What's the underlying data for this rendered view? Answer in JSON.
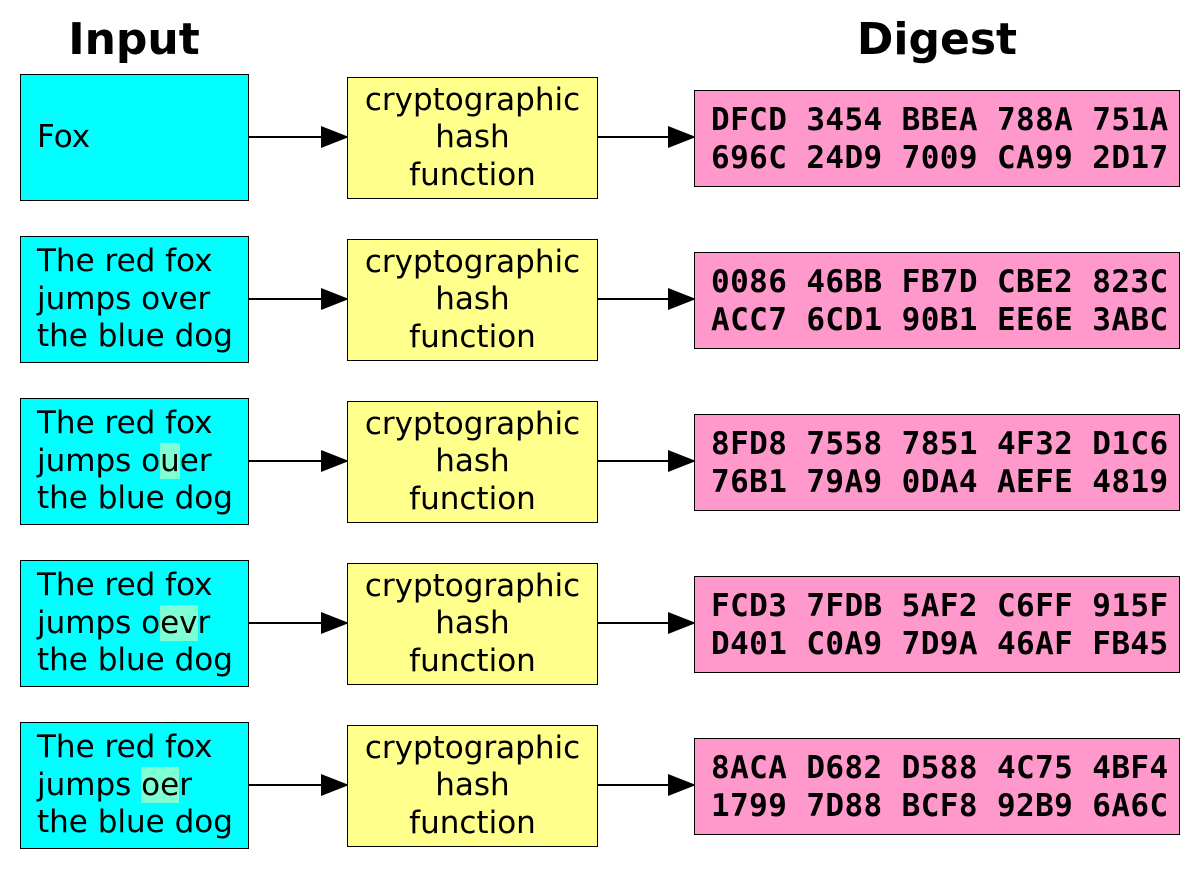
{
  "headers": {
    "input": "Input",
    "digest": "Digest"
  },
  "colors": {
    "input_box": "#00ffff",
    "hash_box": "#ffff8c",
    "digest_box": "#ff99cc",
    "highlight": "#7fffd4"
  },
  "hash_function_label": [
    "cryptographic",
    "hash",
    "function"
  ],
  "rows": [
    {
      "input_lines": [
        [
          {
            "text": "Fox",
            "highlight": false
          }
        ]
      ],
      "digest_lines": [
        "DFCD 3454 BBEA 788A 751A",
        "696C 24D9 7009 CA99 2D17"
      ]
    },
    {
      "input_lines": [
        [
          {
            "text": "The red fox",
            "highlight": false
          }
        ],
        [
          {
            "text": "jumps over",
            "highlight": false
          }
        ],
        [
          {
            "text": "the blue dog",
            "highlight": false
          }
        ]
      ],
      "digest_lines": [
        "0086 46BB FB7D CBE2 823C",
        "ACC7 6CD1 90B1 EE6E 3ABC"
      ]
    },
    {
      "input_lines": [
        [
          {
            "text": "The red fox",
            "highlight": false
          }
        ],
        [
          {
            "text": "jumps o",
            "highlight": false
          },
          {
            "text": "u",
            "highlight": true
          },
          {
            "text": "er",
            "highlight": false
          }
        ],
        [
          {
            "text": "the blue dog",
            "highlight": false
          }
        ]
      ],
      "digest_lines": [
        "8FD8 7558 7851 4F32 D1C6",
        "76B1 79A9 0DA4 AEFE 4819"
      ]
    },
    {
      "input_lines": [
        [
          {
            "text": "The red fox",
            "highlight": false
          }
        ],
        [
          {
            "text": "jumps o",
            "highlight": false
          },
          {
            "text": "ev",
            "highlight": true
          },
          {
            "text": "r",
            "highlight": false
          }
        ],
        [
          {
            "text": "the blue dog",
            "highlight": false
          }
        ]
      ],
      "digest_lines": [
        "FCD3 7FDB 5AF2 C6FF 915F",
        "D401 C0A9 7D9A 46AF FB45"
      ]
    },
    {
      "input_lines": [
        [
          {
            "text": "The red fox",
            "highlight": false
          }
        ],
        [
          {
            "text": "jumps ",
            "highlight": false
          },
          {
            "text": "oe",
            "highlight": true
          },
          {
            "text": "r",
            "highlight": false
          }
        ],
        [
          {
            "text": "the blue dog",
            "highlight": false
          }
        ]
      ],
      "digest_lines": [
        "8ACA D682 D588 4C75 4BF4",
        "1799 7D88 BCF8 92B9 6A6C"
      ]
    }
  ]
}
